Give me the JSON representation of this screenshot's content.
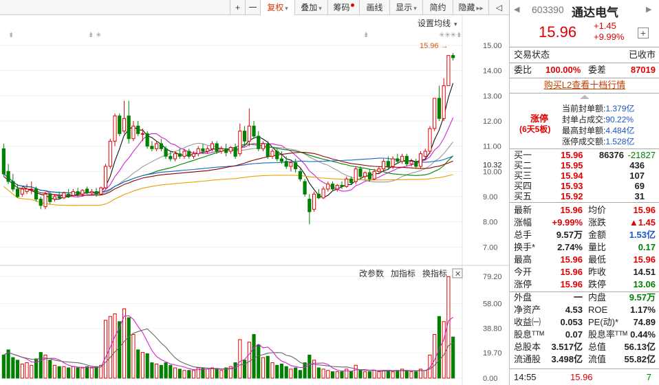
{
  "toolbar": {
    "plus": "+",
    "minus": "一",
    "items": [
      {
        "label": "复权",
        "caret": "▾",
        "active": true
      },
      {
        "label": "叠加",
        "caret": "▾"
      },
      {
        "label": "筹码",
        "dot": true
      },
      {
        "label": "画线"
      },
      {
        "label": "显示",
        "caret": "▾"
      },
      {
        "label": "简约"
      },
      {
        "label": "隐藏",
        "arrow": "▸▸"
      }
    ],
    "expand": "◁"
  },
  "chart": {
    "ma_setting": "设置均线",
    "ma_caret": "▾",
    "price_flag": "15.96 →",
    "price_ticks": [
      "15.00",
      "14.00",
      "13.00",
      "12.00",
      "11.00",
      "10.32",
      "10.00",
      "9.00",
      "8.00",
      "7.00"
    ],
    "volume_ticks": [
      "79.20",
      "58.00",
      "38.80",
      "19.70",
      "0.00"
    ],
    "indicator_buttons": [
      "改参数",
      "加指标",
      "换指标"
    ],
    "close_glyph": "✕",
    "markers_left": [
      "⇟",
      "⇟ ✳",
      "⇟",
      "⇟",
      "✳✳✳⇟"
    ]
  },
  "chart_data": {
    "type": "candlestick",
    "price_axis": [
      7.0,
      15.0
    ],
    "volume_axis": [
      0,
      79.2
    ],
    "candles": [
      {
        "o": 10.9,
        "h": 11.1,
        "c": 9.9,
        "l": 9.8,
        "v": 18
      },
      {
        "o": 10.0,
        "h": 10.3,
        "c": 9.6,
        "l": 9.5,
        "v": 22
      },
      {
        "o": 9.6,
        "h": 9.9,
        "c": 9.3,
        "l": 9.2,
        "v": 16
      },
      {
        "o": 9.3,
        "h": 9.5,
        "c": 9.0,
        "l": 8.95,
        "v": 14
      },
      {
        "o": 9.1,
        "h": 9.4,
        "c": 9.3,
        "l": 9.0,
        "v": 11
      },
      {
        "o": 9.2,
        "h": 9.5,
        "c": 9.3,
        "l": 9.1,
        "v": 12
      },
      {
        "o": 9.3,
        "h": 9.6,
        "c": 9.3,
        "l": 9.1,
        "v": 10
      },
      {
        "o": 9.3,
        "h": 9.4,
        "c": 8.9,
        "l": 8.8,
        "v": 15
      },
      {
        "o": 8.9,
        "h": 9.0,
        "c": 8.65,
        "l": 8.5,
        "v": 20
      },
      {
        "o": 8.6,
        "h": 9.2,
        "c": 9.1,
        "l": 8.5,
        "v": 18
      },
      {
        "o": 9.1,
        "h": 9.2,
        "c": 8.8,
        "l": 8.7,
        "v": 14
      },
      {
        "o": 8.9,
        "h": 9.1,
        "c": 9.0,
        "l": 8.8,
        "v": 10
      },
      {
        "o": 9.0,
        "h": 9.2,
        "c": 8.95,
        "l": 8.9,
        "v": 9
      },
      {
        "o": 8.95,
        "h": 9.2,
        "c": 9.15,
        "l": 8.9,
        "v": 9
      },
      {
        "o": 9.1,
        "h": 9.3,
        "c": 9.0,
        "l": 8.95,
        "v": 8
      },
      {
        "o": 9.05,
        "h": 9.3,
        "c": 9.2,
        "l": 9.0,
        "v": 9
      },
      {
        "o": 9.2,
        "h": 9.35,
        "c": 9.1,
        "l": 9.0,
        "v": 8
      },
      {
        "o": 9.1,
        "h": 9.3,
        "c": 9.25,
        "l": 9.0,
        "v": 8
      },
      {
        "o": 9.3,
        "h": 9.4,
        "c": 9.15,
        "l": 9.1,
        "v": 9
      },
      {
        "o": 9.15,
        "h": 9.3,
        "c": 9.2,
        "l": 9.05,
        "v": 8
      },
      {
        "o": 9.2,
        "h": 9.35,
        "c": 9.1,
        "l": 9.0,
        "v": 9
      },
      {
        "o": 9.1,
        "h": 9.4,
        "c": 9.35,
        "l": 9.05,
        "v": 10
      },
      {
        "o": 9.35,
        "h": 10.3,
        "c": 10.2,
        "l": 9.3,
        "v": 45
      },
      {
        "o": 10.2,
        "h": 11.3,
        "c": 11.2,
        "l": 10.1,
        "v": 48
      },
      {
        "o": 11.2,
        "h": 12.3,
        "c": 12.2,
        "l": 11.0,
        "v": 50
      },
      {
        "o": 12.2,
        "h": 12.3,
        "c": 11.5,
        "l": 11.4,
        "v": 44
      },
      {
        "o": 11.6,
        "h": 12.8,
        "c": 12.1,
        "l": 11.5,
        "v": 54
      },
      {
        "o": 12.2,
        "h": 12.8,
        "c": 11.3,
        "l": 11.1,
        "v": 47
      },
      {
        "o": 11.3,
        "h": 12.0,
        "c": 11.8,
        "l": 11.2,
        "v": 34
      },
      {
        "o": 11.8,
        "h": 12.0,
        "c": 11.5,
        "l": 11.4,
        "v": 22
      },
      {
        "o": 11.5,
        "h": 11.7,
        "c": 11.5,
        "l": 11.2,
        "v": 20
      },
      {
        "o": 11.5,
        "h": 11.6,
        "c": 11.0,
        "l": 10.9,
        "v": 19
      },
      {
        "o": 11.0,
        "h": 11.2,
        "c": 10.9,
        "l": 10.8,
        "v": 12
      },
      {
        "o": 10.9,
        "h": 11.2,
        "c": 11.1,
        "l": 10.8,
        "v": 11
      },
      {
        "o": 11.1,
        "h": 11.3,
        "c": 10.9,
        "l": 10.8,
        "v": 10
      },
      {
        "o": 10.9,
        "h": 11.0,
        "c": 10.6,
        "l": 10.5,
        "v": 12
      },
      {
        "o": 10.6,
        "h": 10.8,
        "c": 10.5,
        "l": 10.4,
        "v": 10
      },
      {
        "o": 10.5,
        "h": 10.8,
        "c": 10.7,
        "l": 10.4,
        "v": 8
      },
      {
        "o": 10.7,
        "h": 10.9,
        "c": 10.6,
        "l": 10.5,
        "v": 7
      },
      {
        "o": 10.6,
        "h": 10.9,
        "c": 10.8,
        "l": 10.5,
        "v": 6
      },
      {
        "o": 10.8,
        "h": 10.9,
        "c": 10.6,
        "l": 10.5,
        "v": 6
      },
      {
        "o": 10.6,
        "h": 10.8,
        "c": 10.7,
        "l": 10.5,
        "v": 6
      },
      {
        "o": 10.7,
        "h": 11.0,
        "c": 10.9,
        "l": 10.6,
        "v": 8
      },
      {
        "o": 10.9,
        "h": 11.1,
        "c": 10.8,
        "l": 10.7,
        "v": 8
      },
      {
        "o": 10.8,
        "h": 11.0,
        "c": 10.9,
        "l": 10.7,
        "v": 7
      },
      {
        "o": 10.9,
        "h": 11.2,
        "c": 11.1,
        "l": 10.8,
        "v": 8
      },
      {
        "o": 11.1,
        "h": 11.2,
        "c": 10.8,
        "l": 10.7,
        "v": 7
      },
      {
        "o": 10.8,
        "h": 11.0,
        "c": 10.9,
        "l": 10.7,
        "v": 6
      },
      {
        "o": 10.9,
        "h": 11.1,
        "c": 10.75,
        "l": 10.6,
        "v": 8
      },
      {
        "o": 10.8,
        "h": 11.0,
        "c": 10.95,
        "l": 10.7,
        "v": 9
      },
      {
        "o": 10.95,
        "h": 11.1,
        "c": 10.6,
        "l": 10.5,
        "v": 12
      },
      {
        "o": 10.7,
        "h": 11.9,
        "c": 11.6,
        "l": 10.6,
        "v": 30
      },
      {
        "o": 11.6,
        "h": 11.8,
        "c": 11.2,
        "l": 11.0,
        "v": 14
      },
      {
        "o": 11.2,
        "h": 12.5,
        "c": 11.8,
        "l": 11.0,
        "v": 28
      },
      {
        "o": 11.8,
        "h": 12.0,
        "c": 11.4,
        "l": 11.3,
        "v": 34
      },
      {
        "o": 11.4,
        "h": 11.6,
        "c": 10.9,
        "l": 10.8,
        "v": 26
      },
      {
        "o": 10.9,
        "h": 11.2,
        "c": 11.1,
        "l": 10.8,
        "v": 16
      },
      {
        "o": 11.1,
        "h": 11.2,
        "c": 10.6,
        "l": 10.5,
        "v": 17
      },
      {
        "o": 10.6,
        "h": 10.9,
        "c": 10.8,
        "l": 10.5,
        "v": 12
      },
      {
        "o": 10.8,
        "h": 10.9,
        "c": 10.5,
        "l": 10.4,
        "v": 10
      },
      {
        "o": 10.5,
        "h": 10.8,
        "c": 10.4,
        "l": 10.3,
        "v": 11
      },
      {
        "o": 10.4,
        "h": 10.6,
        "c": 10.2,
        "l": 10.1,
        "v": 9
      },
      {
        "o": 10.2,
        "h": 10.4,
        "c": 10.35,
        "l": 10.0,
        "v": 7
      },
      {
        "o": 10.35,
        "h": 10.5,
        "c": 10.1,
        "l": 9.95,
        "v": 8
      },
      {
        "o": 10.0,
        "h": 10.1,
        "c": 9.7,
        "l": 9.6,
        "v": 6
      },
      {
        "o": 9.6,
        "h": 9.7,
        "c": 9.1,
        "l": 9.0,
        "v": 12
      },
      {
        "o": 8.9,
        "h": 9.1,
        "c": 8.4,
        "l": 7.9,
        "v": 18
      },
      {
        "o": 8.5,
        "h": 9.2,
        "c": 9.1,
        "l": 8.4,
        "v": 14
      },
      {
        "o": 9.1,
        "h": 9.3,
        "c": 8.95,
        "l": 8.9,
        "v": 8
      },
      {
        "o": 8.95,
        "h": 9.4,
        "c": 9.3,
        "l": 8.9,
        "v": 7
      },
      {
        "o": 9.3,
        "h": 9.6,
        "c": 9.5,
        "l": 9.2,
        "v": 6
      },
      {
        "o": 9.5,
        "h": 9.6,
        "c": 9.3,
        "l": 9.25,
        "v": 5
      },
      {
        "o": 9.3,
        "h": 9.5,
        "c": 9.45,
        "l": 9.2,
        "v": 5
      },
      {
        "o": 9.45,
        "h": 9.6,
        "c": 9.4,
        "l": 9.3,
        "v": 5
      },
      {
        "o": 9.4,
        "h": 9.8,
        "c": 9.7,
        "l": 9.35,
        "v": 7
      },
      {
        "o": 9.7,
        "h": 9.8,
        "c": 9.55,
        "l": 9.5,
        "v": 5
      },
      {
        "o": 9.6,
        "h": 10.2,
        "c": 10.1,
        "l": 9.5,
        "v": 10
      },
      {
        "o": 10.1,
        "h": 10.2,
        "c": 9.8,
        "l": 9.7,
        "v": 6
      },
      {
        "o": 9.8,
        "h": 10.0,
        "c": 9.95,
        "l": 9.7,
        "v": 5
      },
      {
        "o": 9.95,
        "h": 10.1,
        "c": 9.7,
        "l": 9.6,
        "v": 5
      },
      {
        "o": 9.7,
        "h": 10.1,
        "c": 10.0,
        "l": 9.65,
        "v": 6
      },
      {
        "o": 10.0,
        "h": 10.2,
        "c": 10.1,
        "l": 9.9,
        "v": 5
      },
      {
        "o": 10.1,
        "h": 10.5,
        "c": 10.4,
        "l": 10.0,
        "v": 6
      },
      {
        "o": 10.4,
        "h": 10.6,
        "c": 10.2,
        "l": 10.1,
        "v": 6
      },
      {
        "o": 10.2,
        "h": 10.6,
        "c": 10.5,
        "l": 10.1,
        "v": 5
      },
      {
        "o": 10.5,
        "h": 10.7,
        "c": 10.4,
        "l": 10.3,
        "v": 6
      },
      {
        "o": 10.4,
        "h": 10.7,
        "c": 10.6,
        "l": 10.3,
        "v": 7
      },
      {
        "o": 10.6,
        "h": 10.7,
        "c": 10.3,
        "l": 10.2,
        "v": 6
      },
      {
        "o": 10.3,
        "h": 10.5,
        "c": 10.4,
        "l": 10.2,
        "v": 5
      },
      {
        "o": 10.4,
        "h": 10.5,
        "c": 10.2,
        "l": 10.1,
        "v": 5
      },
      {
        "o": 10.2,
        "h": 10.8,
        "c": 10.7,
        "l": 10.1,
        "v": 7
      },
      {
        "o": 10.6,
        "h": 10.9,
        "c": 10.8,
        "l": 10.5,
        "v": 6
      },
      {
        "o": 10.8,
        "h": 11.8,
        "c": 11.7,
        "l": 10.7,
        "v": 18
      },
      {
        "o": 11.7,
        "h": 12.9,
        "c": 12.9,
        "l": 11.6,
        "v": 34
      },
      {
        "o": 12.9,
        "h": 13.4,
        "c": 12.1,
        "l": 12.0,
        "v": 48
      },
      {
        "o": 12.1,
        "h": 13.7,
        "c": 13.4,
        "l": 12.0,
        "v": 44
      },
      {
        "o": 13.4,
        "h": 14.6,
        "c": 14.6,
        "l": 13.4,
        "v": 79
      },
      {
        "o": 14.6,
        "h": 14.7,
        "c": 14.51,
        "l": 14.4,
        "v": 32
      }
    ]
  },
  "panel": {
    "code": "603390",
    "name": "通达电气",
    "price": "15.96",
    "change": "+1.45",
    "change_pct": "+9.99%",
    "add_glyph": "+",
    "status_label": "交易状态",
    "status_value": "已收市",
    "webi_label": "委比",
    "webi_value": "100.00%",
    "weicha_label": "委差",
    "weicha_value": "87019",
    "l2_link": "购买L2查看十档行情",
    "limit_tag": "涨停",
    "limit_sub": "(6天5板)",
    "seal": [
      {
        "label": "当前封单额:",
        "value": "1.379亿"
      },
      {
        "label": "封单占成交:",
        "value": "90.22%"
      },
      {
        "label": "最高封单额:",
        "value": "4.484亿"
      },
      {
        "label": "涨停成交额:",
        "value": "1.528亿"
      }
    ],
    "bids": [
      {
        "label": "买一",
        "price": "15.96",
        "vol": "86376",
        "delta": "-21827"
      },
      {
        "label": "买二",
        "price": "15.95",
        "vol": "436",
        "delta": ""
      },
      {
        "label": "买三",
        "price": "15.94",
        "vol": "107",
        "delta": ""
      },
      {
        "label": "买四",
        "price": "15.93",
        "vol": "69",
        "delta": ""
      },
      {
        "label": "买五",
        "price": "15.92",
        "vol": "31",
        "delta": ""
      }
    ],
    "stats": [
      {
        "l1": "最新",
        "v1": "15.96",
        "c1": "red",
        "l2": "均价",
        "v2": "15.96",
        "c2": "red"
      },
      {
        "l1": "涨幅",
        "v1": "+9.99%",
        "c1": "red",
        "l2": "涨跌",
        "v2": "▲1.45",
        "c2": "red"
      },
      {
        "l1": "总手",
        "v1": "9.57万",
        "c1": "dark",
        "l2": "金额",
        "v2": "1.53亿",
        "c2": "blue"
      },
      {
        "l1": "换手*",
        "v1": "2.74%",
        "c1": "dark",
        "l2": "量比",
        "v2": "0.17",
        "c2": "green"
      },
      {
        "l1": "最高",
        "v1": "15.96",
        "c1": "red",
        "l2": "最低",
        "v2": "15.96",
        "c2": "red"
      },
      {
        "l1": "今开",
        "v1": "15.96",
        "c1": "red",
        "l2": "昨收",
        "v2": "14.51",
        "c2": "dark"
      },
      {
        "l1": "涨停",
        "v1": "15.96",
        "c1": "red",
        "l2": "跌停",
        "v2": "13.06",
        "c2": "green"
      }
    ],
    "stats2": [
      {
        "l1": "外盘",
        "v1": "一",
        "c1": "dark",
        "l2": "内盘",
        "v2": "9.57万",
        "c2": "green"
      },
      {
        "l1": "净资产",
        "v1": "4.53",
        "c1": "dark",
        "l2": "ROE",
        "v2": "1.17%",
        "c2": "dark"
      },
      {
        "l1": "收益㈠",
        "v1": "0.053",
        "c1": "dark",
        "l2": "PE(动)*",
        "v2": "74.89",
        "c2": "dark"
      },
      {
        "l1": "股息ᵀᵀᴹ",
        "v1": "0.07",
        "c1": "dark",
        "l2": "股息率ᵀᵀᴹ",
        "v2": "0.44%",
        "c2": "dark"
      },
      {
        "l1": "总股本",
        "v1": "3.517亿",
        "c1": "dark",
        "l2": "总值",
        "v2": "56.13亿",
        "c2": "dark"
      },
      {
        "l1": "流通股",
        "v1": "3.498亿",
        "c1": "dark",
        "l2": "流值",
        "v2": "55.82亿",
        "c2": "dark"
      }
    ],
    "tick": {
      "time": "14:55",
      "price": "15.96",
      "vol": "7"
    }
  }
}
